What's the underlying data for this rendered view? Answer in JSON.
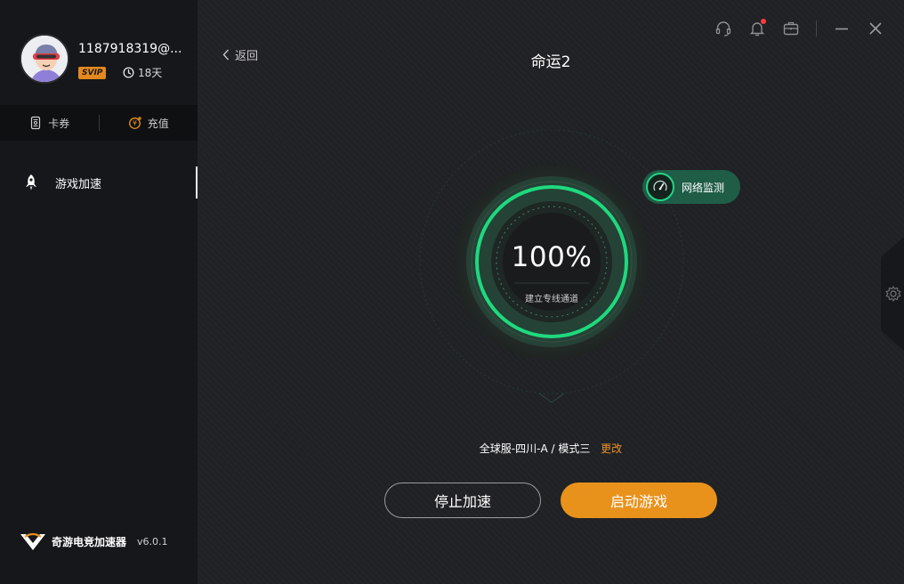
{
  "user": {
    "name": "1187918319@...",
    "badge": "SVIP",
    "days": "18天"
  },
  "quickbar": {
    "card": "卡券",
    "recharge": "充值"
  },
  "nav": {
    "game_boost": "游戏加速"
  },
  "brand": {
    "name": "奇游电竞加速器",
    "version": "v6.0.1"
  },
  "header": {
    "back": "返回",
    "title": "命运2"
  },
  "dial": {
    "percent": "100%",
    "progress": 1.0,
    "status": "建立专线通道"
  },
  "net_monitor": {
    "label": "网络监测"
  },
  "server": {
    "text": "全球服-四川-A / 模式三",
    "change": "更改"
  },
  "buttons": {
    "stop": "停止加速",
    "start": "启动游戏"
  },
  "colors": {
    "accent_orange": "#e8921c",
    "progress_green": "#1ed97e",
    "sidebar_bg": "#16171a",
    "main_bg": "#202124"
  },
  "icons": {
    "support": "headset-icon",
    "notify": "bell-icon",
    "toolbox": "briefcase-icon",
    "minimize": "minimize-icon",
    "close": "close-icon",
    "settings": "gear-icon"
  }
}
